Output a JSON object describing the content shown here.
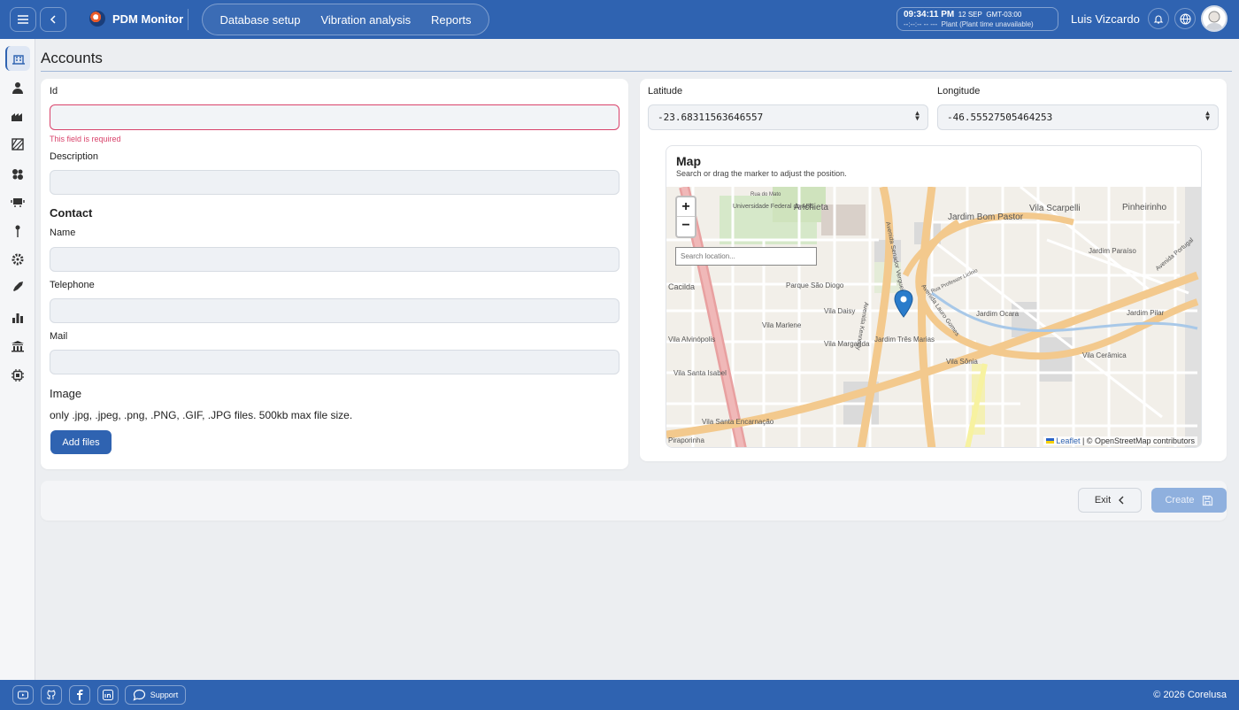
{
  "header": {
    "app_name": "PDM Monitor",
    "nav": [
      "Database setup",
      "Vibration analysis",
      "Reports"
    ],
    "clock": {
      "time": "09:34:11 PM",
      "date": "12 SEP",
      "tz": "GMT-03:00",
      "plant_time": "--:--:-- -- ---",
      "plant_note": "Plant (Plant time unavailable)"
    },
    "user_name": "Luis Vizcardo"
  },
  "page": {
    "title": "Accounts"
  },
  "form": {
    "id_label": "Id",
    "id_error": "This field is required",
    "description_label": "Description",
    "contact_heading": "Contact",
    "name_label": "Name",
    "telephone_label": "Telephone",
    "mail_label": "Mail",
    "image_label": "Image",
    "image_hint": "only .jpg, .jpeg, .png, .PNG, .GIF, .JPG files. 500kb max file size.",
    "add_files_label": "Add files"
  },
  "location": {
    "latitude_label": "Latitude",
    "latitude_value": "-23.68311563646557",
    "longitude_label": "Longitude",
    "longitude_value": "-46.55527505464253"
  },
  "map": {
    "title": "Map",
    "subtitle": "Search or drag the marker to adjust the position.",
    "search_placeholder": "Search location...",
    "zoom_in": "+",
    "zoom_out": "−",
    "attribution_link": "Leaflet",
    "attribution_text": "| © OpenStreetMap contributors",
    "labels": [
      "Universidade Federal do ABC",
      "Anchieta",
      "Jardim Bom Pastor",
      "Vila Scarpelli",
      "Pinheirinho",
      "Parque São Diogo",
      "Vila Daisy",
      "Vila Marlene",
      "Jardim Ocara",
      "Jardim Paraíso",
      "Jardim Pilar",
      "Vila Margarida",
      "Jardim Três Marias",
      "Vila Sônia",
      "Vila Cerâmica",
      "Vila Santa Isabel",
      "Vila Santa Encarnação",
      "Cacilda",
      "Vila Alvinópolis",
      "Piraporinha",
      "Avenida Senador Vergueiro",
      "Avenida Kennedy",
      "Avenida Lauro Gomes",
      "Avenida Portugal",
      "Rua do Mato",
      "Rua Professor Licínio"
    ]
  },
  "actions": {
    "exit_label": "Exit",
    "create_label": "Create"
  },
  "footer": {
    "support_label": "Support",
    "copyright": "© 2026 Corelusa"
  },
  "colors": {
    "primary": "#2f63b1",
    "error": "#d9436b",
    "background": "#eceef1"
  }
}
